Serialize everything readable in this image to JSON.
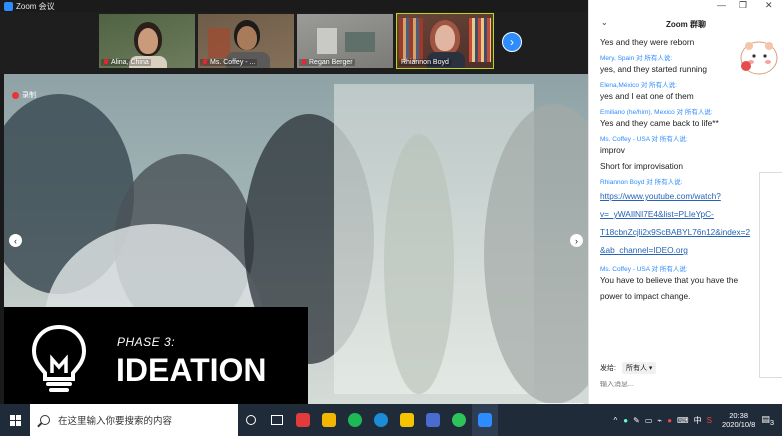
{
  "window": {
    "title": "Zoom 会议"
  },
  "participants": [
    {
      "name": "Alina, China",
      "muted": true,
      "bg": "#5a6b4a",
      "skin": "#c99b7a",
      "hair": "#2a1f1a"
    },
    {
      "name": "Ms. Coffey - ...",
      "muted": true,
      "bg": "#6b5b4a",
      "skin": "#a87b5a",
      "hair": "#1e1a18"
    },
    {
      "name": "Regan Berger",
      "muted": true,
      "bg": "#8a8a8a",
      "skin": "#ffffff",
      "hair": "#777777"
    },
    {
      "name": "Rhiannon Boyd",
      "muted": false,
      "active": true,
      "bg": "#6b4538",
      "skin": "#e0b6a3",
      "hair": "#a05540"
    }
  ],
  "share": {
    "recording_label": "录制",
    "phase_label": "PHASE 3:",
    "phase_title": "IDEATION"
  },
  "chat": {
    "title": "Zoom 群聊",
    "messages": [
      {
        "sender": "",
        "to": "",
        "lines": [
          "Yes and they were reborn"
        ]
      },
      {
        "sender": "Mery, Spain",
        "to": "所有人说:",
        "lines": [
          "yes, and they started running"
        ]
      },
      {
        "sender": "Elena,México",
        "to": "所有人说:",
        "lines": [
          "yes and I eat one of them"
        ]
      },
      {
        "sender": "Emiliano (he/him), Mexico",
        "to": "所有人说:",
        "lines": [
          "Yes and they came back to life**"
        ]
      },
      {
        "sender": "Ms. Coffey - USA",
        "to": "所有人说:",
        "lines": [
          "improv",
          "Short for improvisation"
        ]
      },
      {
        "sender": "Rhiannon Boyd",
        "to": "所有人说:",
        "link": true,
        "lines": [
          "https://www.youtube.com/watch?",
          "v=_yWAIlNI7E4&list=PLIeYpC-",
          "T18cbnZcjli2x9ScBABYL76n12&index=2",
          "&ab_channel=IDEO.org"
        ]
      },
      {
        "sender": "Ms. Coffey - USA",
        "to": "所有人说:",
        "lines": [
          "You have to believe that you have the",
          "power to impact change."
        ]
      }
    ],
    "to_word": "对",
    "send_to_label": "发给:",
    "send_to_value": "所有人 ▾",
    "input_placeholder": "输入消息..."
  },
  "taskbar": {
    "search_placeholder": "在这里输入你要搜索的内容",
    "time": "20:38",
    "date": "2020/10/8",
    "ime": "中",
    "notifications": "3"
  },
  "colors": {
    "accent": "#2d8cff",
    "active_border": "#b7d91a",
    "taskbar": "#202b3a",
    "muted_icon": "#e22233"
  }
}
